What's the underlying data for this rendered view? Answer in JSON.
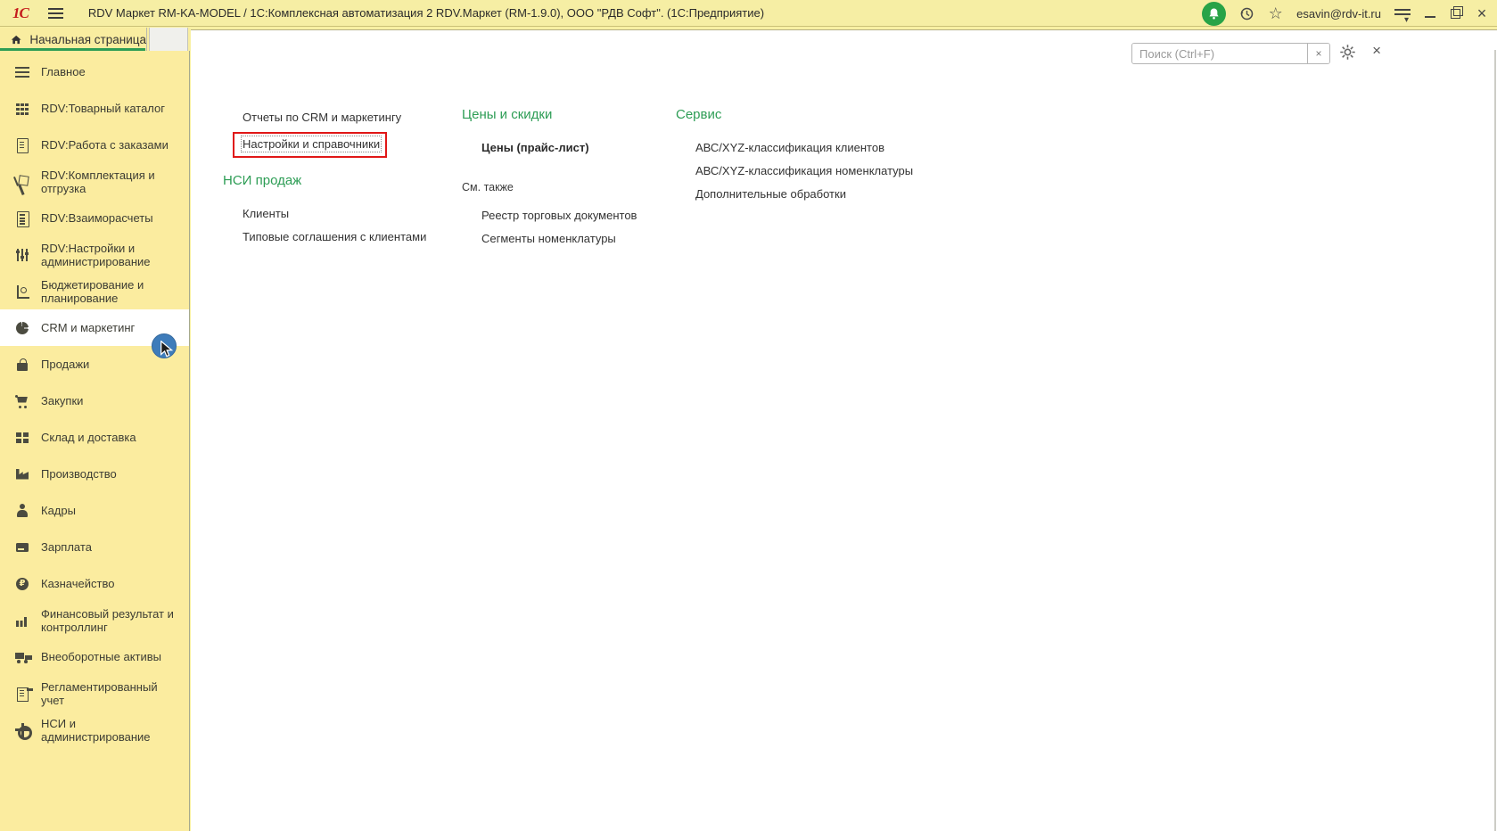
{
  "titlebar": {
    "logo": "1С",
    "title": "RDV Маркет RM-KA-MODEL / 1С:Комплексная автоматизация 2 RDV.Маркет (RM-1.9.0), ООО \"РДВ Софт\".  (1С:Предприятие)",
    "user_email": "esavin@rdv-it.ru"
  },
  "tabbar": {
    "home_tab_label": "Начальная страница"
  },
  "search": {
    "placeholder": "Поиск (Ctrl+F)"
  },
  "glyphs": {
    "star": "☆",
    "clear": "×",
    "close_small": "×",
    "window_close": "×",
    "caret_down": "▾"
  },
  "colors": {
    "accent_green": "#2d9d55",
    "annotation_red": "#e01717",
    "notification_green": "#28a347",
    "touch_cursor_blue": "#3e7cba"
  },
  "sidebar": {
    "items": [
      {
        "label": "Главное",
        "icon": "main-menu"
      },
      {
        "label": "RDV:Товарный каталог",
        "icon": "catalog-grid"
      },
      {
        "label": "RDV:Работа с заказами",
        "icon": "orders-doc"
      },
      {
        "label": "RDV:Комплектация и отгрузка",
        "icon": "handtruck"
      },
      {
        "label": "RDV:Взаиморасчеты",
        "icon": "calculator"
      },
      {
        "label": "RDV:Настройки и администрирование",
        "icon": "sliders"
      },
      {
        "label": "Бюджетирование и планирование",
        "icon": "chart-axis"
      },
      {
        "label": "CRM и маркетинг",
        "icon": "pie-chart",
        "active": true
      },
      {
        "label": "Продажи",
        "icon": "bag"
      },
      {
        "label": "Закупки",
        "icon": "cart"
      },
      {
        "label": "Склад и доставка",
        "icon": "warehouse"
      },
      {
        "label": "Производство",
        "icon": "factory"
      },
      {
        "label": "Кадры",
        "icon": "person"
      },
      {
        "label": "Зарплата",
        "icon": "card"
      },
      {
        "label": "Казначейство",
        "icon": "ruble"
      },
      {
        "label": "Финансовый результат и контроллинг",
        "icon": "barchart"
      },
      {
        "label": "Внеоборотные активы",
        "icon": "truck"
      },
      {
        "label": "Регламентированный учет",
        "icon": "register"
      },
      {
        "label": "НСИ и администрирование",
        "icon": "gear"
      }
    ]
  },
  "menu": {
    "columns": [
      {
        "sections": [
          {
            "header": null,
            "items": [
              {
                "label": "Отчеты по CRM и маркетингу"
              },
              {
                "label": "Настройки и справочники",
                "highlighted": true
              }
            ]
          },
          {
            "header": "НСИ продаж",
            "header_style": "green",
            "items": [
              {
                "label": "Клиенты"
              },
              {
                "label": "Типовые соглашения с клиентами"
              }
            ]
          }
        ]
      },
      {
        "sections": [
          {
            "header": "Цены и скидки",
            "header_style": "green",
            "items": [
              {
                "label": "Цены (прайс-лист)",
                "bold": true
              }
            ]
          },
          {
            "header": "См. также",
            "header_style": "plain",
            "items": [
              {
                "label": "Реестр торговых документов"
              },
              {
                "label": "Сегменты номенклатуры"
              }
            ]
          }
        ]
      },
      {
        "sections": [
          {
            "header": "Сервис",
            "header_style": "green",
            "items": [
              {
                "label": "АВС/XYZ-классификация клиентов"
              },
              {
                "label": "АВС/XYZ-классификация номенклатуры"
              },
              {
                "label": "Дополнительные обработки"
              }
            ]
          }
        ]
      }
    ]
  }
}
